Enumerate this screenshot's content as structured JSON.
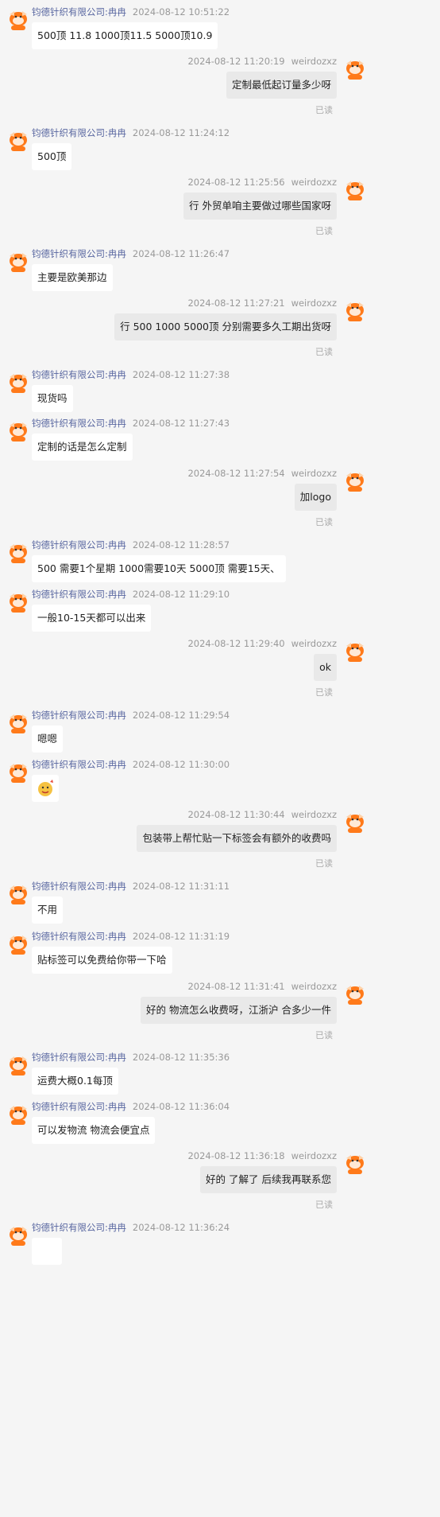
{
  "colors": {
    "background": "#f5f5f5",
    "sender_name": "#5866a0",
    "timestamp": "#999999",
    "left_bubble": "#ffffff",
    "right_bubble": "#e9e9e9",
    "avatar_orange": "#ff7a1a"
  },
  "messages": [
    {
      "side": "left",
      "sender": "钧德针织有限公司:冉冉",
      "time": "2024-08-12 10:51:22",
      "text": "500顶 11.8  1000顶11.5   5000顶10.9"
    },
    {
      "side": "right",
      "sender": "weirdozxz",
      "time": "2024-08-12 11:20:19",
      "text": "定制最低起订量多少呀",
      "status": "已读"
    },
    {
      "side": "left",
      "sender": "钧德针织有限公司:冉冉",
      "time": "2024-08-12 11:24:12",
      "text": "500顶"
    },
    {
      "side": "right",
      "sender": "weirdozxz",
      "time": "2024-08-12 11:25:56",
      "text": "行 外贸单咱主要做过哪些国家呀",
      "status": "已读"
    },
    {
      "side": "left",
      "sender": "钧德针织有限公司:冉冉",
      "time": "2024-08-12 11:26:47",
      "text": "主要是欧美那边"
    },
    {
      "side": "right",
      "sender": "weirdozxz",
      "time": "2024-08-12 11:27:21",
      "text": "行 500 1000 5000顶 分别需要多久工期出货呀",
      "status": "已读"
    },
    {
      "side": "left",
      "sender": "钧德针织有限公司:冉冉",
      "time": "2024-08-12 11:27:38",
      "text": "现货吗"
    },
    {
      "side": "left",
      "sender": "钧德针织有限公司:冉冉",
      "time": "2024-08-12 11:27:43",
      "text": "定制的话是怎么定制"
    },
    {
      "side": "right",
      "sender": "weirdozxz",
      "time": "2024-08-12 11:27:54",
      "text": "加logo",
      "status": "已读"
    },
    {
      "side": "left",
      "sender": "钧德针织有限公司:冉冉",
      "time": "2024-08-12 11:28:57",
      "text": "500 需要1个星期 1000需要10天 5000顶 需要15天、"
    },
    {
      "side": "left",
      "sender": "钧德针织有限公司:冉冉",
      "time": "2024-08-12 11:29:10",
      "text": "一般10-15天都可以出来"
    },
    {
      "side": "right",
      "sender": "weirdozxz",
      "time": "2024-08-12 11:29:40",
      "text": "ok",
      "status": "已读"
    },
    {
      "side": "left",
      "sender": "钧德针织有限公司:冉冉",
      "time": "2024-08-12 11:29:54",
      "text": "嗯嗯"
    },
    {
      "side": "left",
      "sender": "钧德针织有限公司:冉冉",
      "time": "2024-08-12 11:30:00",
      "text": "",
      "sticker": "emoji-sticker"
    },
    {
      "side": "right",
      "sender": "weirdozxz",
      "time": "2024-08-12 11:30:44",
      "text": "包装带上帮忙贴一下标签会有额外的收费吗",
      "status": "已读"
    },
    {
      "side": "left",
      "sender": "钧德针织有限公司:冉冉",
      "time": "2024-08-12 11:31:11",
      "text": "不用"
    },
    {
      "side": "left",
      "sender": "钧德针织有限公司:冉冉",
      "time": "2024-08-12 11:31:19",
      "text": "贴标签可以免费给你带一下哈"
    },
    {
      "side": "right",
      "sender": "weirdozxz",
      "time": "2024-08-12 11:31:41",
      "text": "好的  物流怎么收费呀，江浙沪 合多少一件",
      "status": "已读"
    },
    {
      "side": "left",
      "sender": "钧德针织有限公司:冉冉",
      "time": "2024-08-12 11:35:36",
      "text": "运费大概0.1每顶"
    },
    {
      "side": "left",
      "sender": "钧德针织有限公司:冉冉",
      "time": "2024-08-12 11:36:04",
      "text": "可以发物流  物流会便宜点"
    },
    {
      "side": "right",
      "sender": "weirdozxz",
      "time": "2024-08-12 11:36:18",
      "text": "好的 了解了 后续我再联系您",
      "status": "已读"
    },
    {
      "side": "left",
      "sender": "钧德针织有限公司:冉冉",
      "time": "2024-08-12 11:36:24",
      "text": ""
    }
  ]
}
